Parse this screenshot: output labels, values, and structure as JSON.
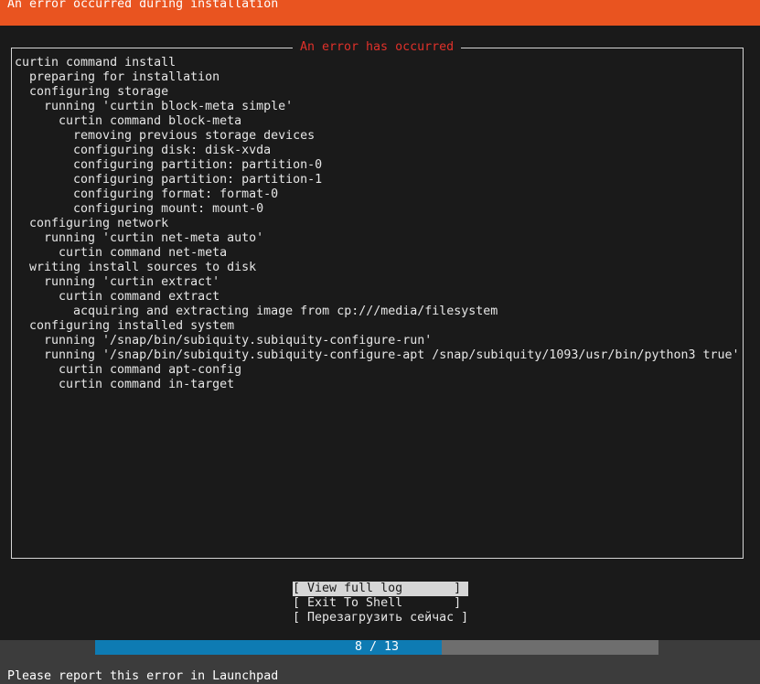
{
  "header": {
    "title": "An error occurred during installation",
    "color": "#e95420"
  },
  "log": {
    "title": "An error has occurred",
    "lines": [
      {
        "indent": 0,
        "text": "curtin command install"
      },
      {
        "indent": 1,
        "text": "preparing for installation"
      },
      {
        "indent": 1,
        "text": "configuring storage"
      },
      {
        "indent": 2,
        "text": "running 'curtin block-meta simple'"
      },
      {
        "indent": 3,
        "text": "curtin command block-meta"
      },
      {
        "indent": 4,
        "text": "removing previous storage devices"
      },
      {
        "indent": 4,
        "text": "configuring disk: disk-xvda"
      },
      {
        "indent": 4,
        "text": "configuring partition: partition-0"
      },
      {
        "indent": 4,
        "text": "configuring partition: partition-1"
      },
      {
        "indent": 4,
        "text": "configuring format: format-0"
      },
      {
        "indent": 4,
        "text": "configuring mount: mount-0"
      },
      {
        "indent": 1,
        "text": "configuring network"
      },
      {
        "indent": 2,
        "text": "running 'curtin net-meta auto'"
      },
      {
        "indent": 3,
        "text": "curtin command net-meta"
      },
      {
        "indent": 1,
        "text": "writing install sources to disk"
      },
      {
        "indent": 2,
        "text": "running 'curtin extract'"
      },
      {
        "indent": 3,
        "text": "curtin command extract"
      },
      {
        "indent": 4,
        "text": "acquiring and extracting image from cp:///media/filesystem"
      },
      {
        "indent": 1,
        "text": "configuring installed system"
      },
      {
        "indent": 2,
        "text": "running '/snap/bin/subiquity.subiquity-configure-run'"
      },
      {
        "indent": 2,
        "text": "running '/snap/bin/subiquity.subiquity-configure-apt /snap/subiquity/1093/usr/bin/python3 true'"
      },
      {
        "indent": 3,
        "text": "curtin command apt-config"
      },
      {
        "indent": 3,
        "text": "curtin command in-target"
      }
    ]
  },
  "buttons": [
    {
      "label": "[ View full log       ]",
      "selected": true
    },
    {
      "label": "[ Exit To Shell       ]",
      "selected": false
    },
    {
      "label": "[ Перезагрузить сейчас ]",
      "selected": false
    }
  ],
  "progress": {
    "label": "8 / 13",
    "current": 8,
    "total": 13,
    "fill_color": "#0e7bb3"
  },
  "footer": {
    "text": "Please report this error in Launchpad"
  }
}
